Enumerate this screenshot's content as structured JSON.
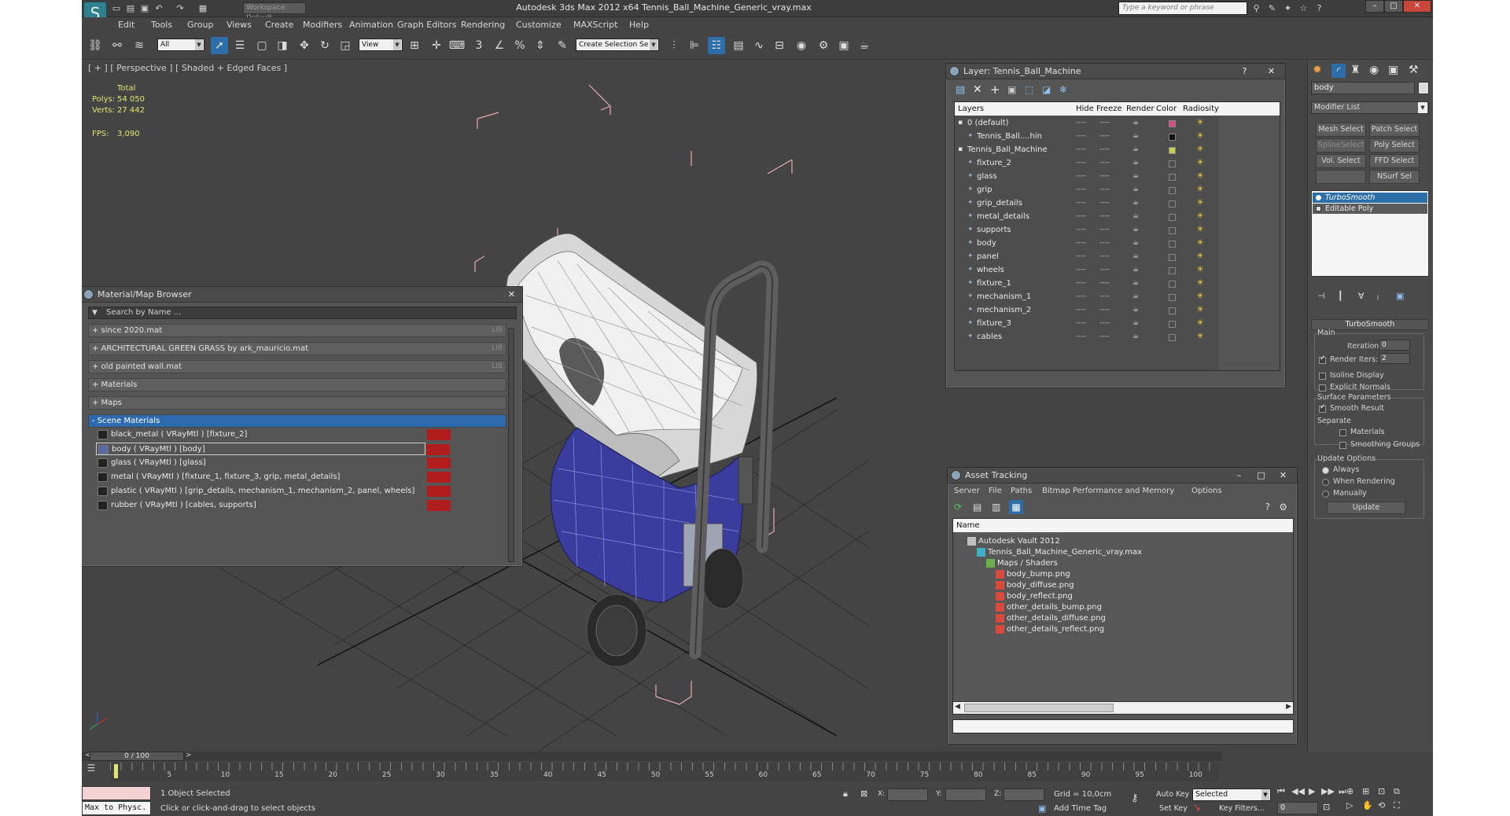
{
  "app": {
    "title": "Autodesk 3ds Max  2012 x64    Tennis_Ball_Machine_Generic_vray.max",
    "workspace": "Workspace: Default",
    "search_placeholder": "Type a keyword or phrase"
  },
  "menu": [
    "Edit",
    "Tools",
    "Group",
    "Views",
    "Create",
    "Modifiers",
    "Animation",
    "Graph Editors",
    "Rendering",
    "Customize",
    "MAXScript",
    "Help"
  ],
  "toolbar": {
    "filter_value": "All",
    "ref_coord": "View",
    "selection_set_placeholder": "Create Selection Se"
  },
  "viewport": {
    "label": "[ + ] [ Perspective ] [ Shaded + Edged Faces ]",
    "stats": {
      "total_label": "Total",
      "polys_label": "Polys:",
      "polys": "54 050",
      "verts_label": "Verts:",
      "verts": "27 442",
      "fps_label": "FPS:",
      "fps": "3,090"
    }
  },
  "material_browser": {
    "title": "Material/Map Browser",
    "search_placeholder": "Search by Name ...",
    "libraries": [
      {
        "label": "+ since 2020.mat",
        "tag": "LIB"
      },
      {
        "label": "+ ARCHITECTURAL GREEN GRASS by ark_mauricio.mat",
        "tag": "LIB"
      },
      {
        "label": "+ old painted wall.mat",
        "tag": "LIB"
      },
      {
        "label": "+ Materials",
        "tag": ""
      },
      {
        "label": "+ Maps",
        "tag": ""
      }
    ],
    "scene_header": "- Scene Materials",
    "materials": [
      "black_metal  ( VRayMtl )  [fixture_2]",
      "body  ( VRayMtl )  [body]",
      "glass  ( VRayMtl )  [glass]",
      "metal  ( VRayMtl )  [fixture_1, fixture_3, grip, metal_details]",
      "plastic  ( VRayMtl )  [grip_details, mechanism_1, mechanism_2, panel, wheels]",
      "rubber  ( VRayMtl )  [cables, supports]"
    ]
  },
  "layer_manager": {
    "title": "Layer: Tennis_Ball_Machine",
    "columns": [
      "Layers",
      "Hide",
      "Freeze",
      "Render",
      "Color",
      "Radiosity"
    ],
    "rows": [
      {
        "name": "0 (default)",
        "indent": 0,
        "color": "#d94a86"
      },
      {
        "name": "Tennis_Ball....hin",
        "indent": 2,
        "color": "#111111"
      },
      {
        "name": "Tennis_Ball_Machine",
        "indent": 0,
        "color": "#c6d04a"
      },
      {
        "name": "fixture_2",
        "indent": 1,
        "color": ""
      },
      {
        "name": "glass",
        "indent": 1,
        "color": ""
      },
      {
        "name": "grip",
        "indent": 1,
        "color": ""
      },
      {
        "name": "grip_details",
        "indent": 1,
        "color": ""
      },
      {
        "name": "metal_details",
        "indent": 1,
        "color": ""
      },
      {
        "name": "supports",
        "indent": 1,
        "color": ""
      },
      {
        "name": "body",
        "indent": 1,
        "color": ""
      },
      {
        "name": "panel",
        "indent": 1,
        "color": ""
      },
      {
        "name": "wheels",
        "indent": 1,
        "color": ""
      },
      {
        "name": "fixture_1",
        "indent": 1,
        "color": ""
      },
      {
        "name": "mechanism_1",
        "indent": 1,
        "color": ""
      },
      {
        "name": "mechanism_2",
        "indent": 1,
        "color": ""
      },
      {
        "name": "fixture_3",
        "indent": 1,
        "color": ""
      },
      {
        "name": "cables",
        "indent": 1,
        "color": ""
      }
    ]
  },
  "asset_tracking": {
    "title": "Asset Tracking",
    "menu": [
      "Server",
      "File",
      "Paths",
      "Bitmap Performance and Memory",
      "Options"
    ],
    "column": "Name",
    "rows": [
      {
        "name": "Autodesk Vault 2012",
        "indent": 0,
        "icon": "vault"
      },
      {
        "name": "Tennis_Ball_Machine_Generic_vray.max",
        "indent": 1,
        "icon": "max"
      },
      {
        "name": "Maps / Shaders",
        "indent": 2,
        "icon": "maps"
      },
      {
        "name": "body_bump.png",
        "indent": 3,
        "icon": "png"
      },
      {
        "name": "body_diffuse.png",
        "indent": 3,
        "icon": "png"
      },
      {
        "name": "body_reflect.png",
        "indent": 3,
        "icon": "png"
      },
      {
        "name": "other_details_bump.png",
        "indent": 3,
        "icon": "png"
      },
      {
        "name": "other_details_diffuse.png",
        "indent": 3,
        "icon": "png"
      },
      {
        "name": "other_details_reflect.png",
        "indent": 3,
        "icon": "png"
      }
    ]
  },
  "command_panel": {
    "object_name": "body",
    "modifier_list": "Modifier List",
    "buttons": [
      "Mesh Select",
      "Patch Select",
      "SplineSelect",
      "Poly Select",
      "Vol. Select",
      "FFD Select",
      "",
      "NSurf Sel"
    ],
    "stack": [
      "TurboSmooth",
      "Editable Poly"
    ],
    "rollout_title": "TurboSmooth",
    "main_label": "Main",
    "iterations_label": "Iterations:",
    "iterations": "0",
    "render_iters_label": "Render Iters:",
    "render_iters": "2",
    "isoline": "Isoline Display",
    "explicit": "Explicit Normals",
    "surface_params": "Surface Parameters",
    "smooth_result": "Smooth Result",
    "separate": "Separate",
    "materials": "Materials",
    "smoothing_groups": "Smoothing Groups",
    "update_options": "Update Options",
    "always": "Always",
    "when_rendering": "When Rendering",
    "manually": "Manually",
    "update_btn": "Update"
  },
  "timeline": {
    "frame": "0 / 100",
    "ticks": [
      "0",
      "5",
      "10",
      "15",
      "20",
      "25",
      "30",
      "35",
      "40",
      "45",
      "50",
      "55",
      "60",
      "65",
      "70",
      "75",
      "80",
      "85",
      "90",
      "95",
      "100"
    ]
  },
  "status": {
    "maxscript": "Max to Physc.",
    "selected": "1 Object Selected",
    "prompt": "Click or click-and-drag to select objects",
    "x_label": "X:",
    "y_label": "Y:",
    "z_label": "Z:",
    "grid": "Grid = 10,0cm",
    "add_time_tag": "Add Time Tag",
    "auto_key": "Auto Key",
    "selected_dd": "Selected",
    "set_key": "Set Key",
    "key_filters": "Key Filters...",
    "frame_field": "0"
  },
  "colors": {
    "accent": "#2d6ea8",
    "panel": "#555555",
    "viewport": "#444444",
    "stats": "#e3e371"
  }
}
